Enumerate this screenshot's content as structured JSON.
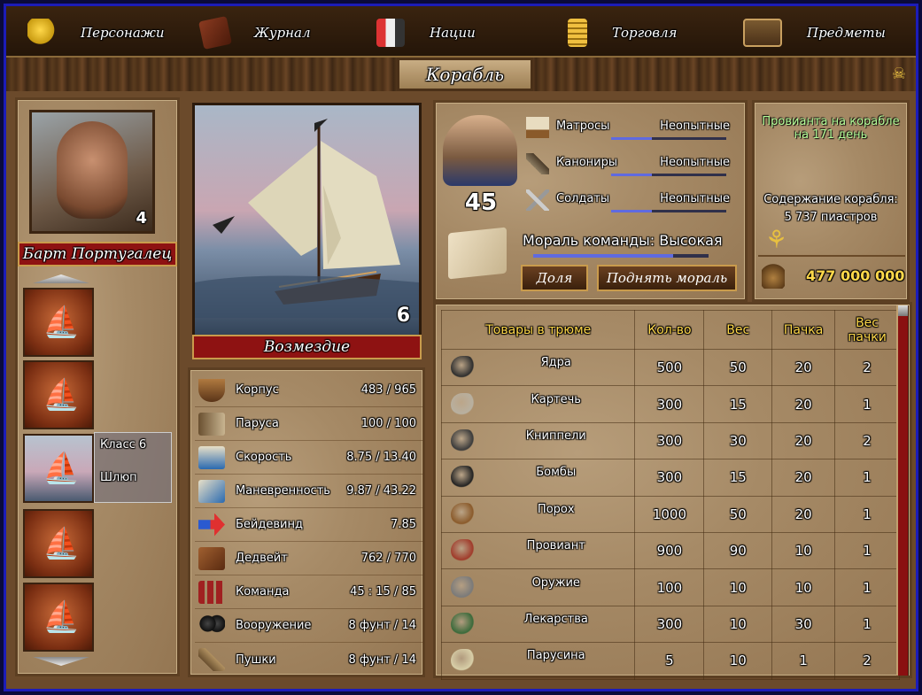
{
  "topnav": {
    "items": [
      {
        "label": "Персонажи",
        "icon": "character-silhouette-icon"
      },
      {
        "label": "Журнал",
        "icon": "journal-book-icon"
      },
      {
        "label": "Нации",
        "icon": "nations-shields-icon"
      },
      {
        "label": "Торговля",
        "icon": "coins-trade-icon"
      },
      {
        "label": "Предметы",
        "icon": "chest-items-icon"
      }
    ]
  },
  "title": "Корабль",
  "captain": {
    "name": "Барт Португалец",
    "level": "4"
  },
  "fleet": {
    "selected": {
      "class_label": "Класс 6",
      "type_label": "Шлюп"
    }
  },
  "ship": {
    "name": "Возмездие",
    "class": "6"
  },
  "stats": [
    {
      "label": "Корпус",
      "value": "483 / 965",
      "icon": "hull-icon"
    },
    {
      "label": "Паруса",
      "value": "100 / 100",
      "icon": "sails-icon"
    },
    {
      "label": "Скорость",
      "value": "8.75 / 13.40",
      "icon": "speed-icon"
    },
    {
      "label": "Маневренность",
      "value": "9.87 / 43.22",
      "icon": "maneuver-icon"
    },
    {
      "label": "Бейдевинд",
      "value": "7.85",
      "icon": "wind-arrow-icon"
    },
    {
      "label": "Дедвейт",
      "value": "762 / 770",
      "icon": "cargo-box-icon"
    },
    {
      "label": "Команда",
      "value": "45 : 15 / 85",
      "icon": "crew-icon"
    },
    {
      "label": "Вооружение",
      "value": "8 фунт / 14",
      "icon": "cannonballs-max-icon"
    },
    {
      "label": "Пушки",
      "value": "8 фунт / 14",
      "icon": "cannon-icon"
    }
  ],
  "crew": {
    "count": "45",
    "rows": [
      {
        "name": "Матросы",
        "level": "Неопытные",
        "icon": "sailor-ship-icon",
        "progress": 0.35
      },
      {
        "name": "Канониры",
        "level": "Неопытные",
        "icon": "cannon-crew-icon",
        "progress": 0.35
      },
      {
        "name": "Солдаты",
        "level": "Неопытные",
        "icon": "soldier-swords-icon",
        "progress": 0.35
      }
    ],
    "morale_text": "Мораль команды: Высокая",
    "morale_progress": 0.8,
    "share_button": "Доля",
    "raise_morale_button": "Поднять мораль"
  },
  "provisions": {
    "text": "Провианта на корабле на 171 день",
    "upkeep_label": "Содержание корабля:",
    "upkeep_value": "5 737 пиастров",
    "money": "477 000 000"
  },
  "cargo": {
    "headers": [
      "Товары в трюме",
      "Кол-во",
      "Вес",
      "Пачка",
      "Вес пачки"
    ],
    "rows": [
      {
        "name": "Ядра",
        "qty": "500",
        "weight": "50",
        "pack": "20",
        "pack_weight": "2",
        "icon": "cannonballs-icon",
        "color": "#2e2e2e"
      },
      {
        "name": "Картечь",
        "qty": "300",
        "weight": "15",
        "pack": "20",
        "pack_weight": "1",
        "icon": "grapeshot-icon",
        "color": "#b8b0a0"
      },
      {
        "name": "Книппели",
        "qty": "300",
        "weight": "30",
        "pack": "20",
        "pack_weight": "2",
        "icon": "chainshot-icon",
        "color": "#3a3a3a"
      },
      {
        "name": "Бомбы",
        "qty": "300",
        "weight": "15",
        "pack": "20",
        "pack_weight": "1",
        "icon": "bombs-icon",
        "color": "#222"
      },
      {
        "name": "Порох",
        "qty": "1000",
        "weight": "50",
        "pack": "20",
        "pack_weight": "1",
        "icon": "powder-barrel-icon",
        "color": "#8a5a2a"
      },
      {
        "name": "Провиант",
        "qty": "900",
        "weight": "90",
        "pack": "10",
        "pack_weight": "1",
        "icon": "provisions-icon",
        "color": "#a03a2a"
      },
      {
        "name": "Оружие",
        "qty": "100",
        "weight": "10",
        "pack": "10",
        "pack_weight": "1",
        "icon": "crossed-swords-icon",
        "color": "#7a7a7a"
      },
      {
        "name": "Лекарства",
        "qty": "300",
        "weight": "10",
        "pack": "30",
        "pack_weight": "1",
        "icon": "medicine-box-icon",
        "color": "#3a6a3a"
      },
      {
        "name": "Парусина",
        "qty": "5",
        "weight": "10",
        "pack": "1",
        "pack_weight": "2",
        "icon": "canvas-rolls-icon",
        "color": "#d8cfa8"
      }
    ]
  }
}
